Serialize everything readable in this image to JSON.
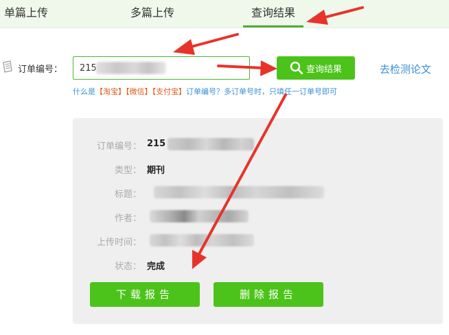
{
  "tabs": [
    {
      "label": "单篇上传"
    },
    {
      "label": "多篇上传"
    },
    {
      "label": "查询结果"
    }
  ],
  "search": {
    "label": "订单编号：",
    "value": "215",
    "button_label": "查询结果",
    "detect_link": "去检测论文"
  },
  "hint": {
    "prefix": "什么是",
    "taobao": "【淘宝】",
    "wechat": "【微信】",
    "alipay": "【支付宝】",
    "suffix": "订单编号？多订单号时，只填任一订单号即可"
  },
  "result": {
    "order_label": "订单编号：",
    "order_value": "215",
    "type_label": "类型：",
    "type_value": "期刊",
    "title_label": "标题：",
    "author_label": "作者：",
    "upload_time_label": "上传时间：",
    "status_label": "状态：",
    "status_value": "完成"
  },
  "actions": {
    "download": "下载报告",
    "delete": "删除报告"
  },
  "colors": {
    "accent_green": "#4cc31a",
    "link_blue": "#3a8fd8",
    "tab_bg": "#f0f8ec",
    "annotation_red": "#e8332a"
  },
  "icons": [
    "order-doc-icon",
    "search-icon"
  ]
}
